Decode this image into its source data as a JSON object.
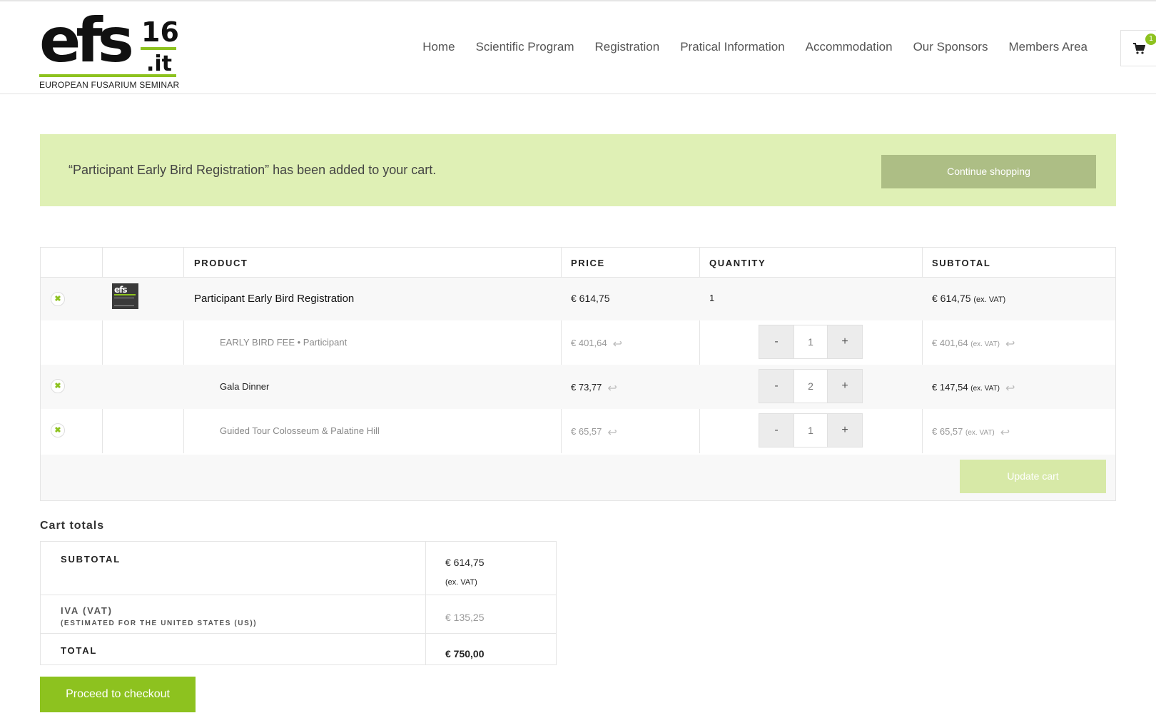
{
  "logo": {
    "mark": "efs",
    "number": "16",
    "domain": ".it",
    "tagline": "EUROPEAN FUSARIUM SEMINAR"
  },
  "nav": {
    "items": [
      "Home",
      "Scientific Program",
      "Registration",
      "Pratical Information",
      "Accommodation",
      "Our Sponsors",
      "Members Area"
    ]
  },
  "cart": {
    "icon": "cart-icon",
    "count": "1"
  },
  "notice": {
    "message": "“Participant Early Bird Registration” has been added to your cart.",
    "continue_label": "Continue shopping"
  },
  "table": {
    "headers": {
      "product": "PRODUCT",
      "price": "PRICE",
      "quantity": "QUANTITY",
      "subtotal": "SUBTOTAL"
    },
    "main_item": {
      "name": "Participant Early Bird Registration",
      "price": "€ 614,75",
      "quantity": "1",
      "subtotal": "€ 614,75",
      "subtotal_suffix": "(ex. VAT)"
    },
    "sub_items": [
      {
        "name": "EARLY BIRD FEE • Participant",
        "price": "€ 401,64",
        "qty": "1",
        "subtotal": "€ 401,64",
        "suffix": "(ex. VAT)",
        "minus": "-",
        "plus": "+"
      },
      {
        "name": "Gala Dinner",
        "price": "€ 73,77",
        "qty": "2",
        "subtotal": "€ 147,54",
        "suffix": "(ex. VAT)",
        "minus": "-",
        "plus": "+"
      },
      {
        "name": "Guided Tour Colosseum & Palatine Hill",
        "price": "€ 65,57",
        "qty": "1",
        "subtotal": "€ 65,57",
        "suffix": "(ex. VAT)",
        "minus": "-",
        "plus": "+"
      }
    ],
    "update_label": "Update cart"
  },
  "totals": {
    "title": "Cart totals",
    "subtotal_label": "SUBTOTAL",
    "subtotal_value": "€ 614,75",
    "subtotal_note": "(ex. VAT)",
    "vat_label": "IVA (VAT)",
    "vat_note": "(ESTIMATED FOR THE UNITED STATES (US))",
    "vat_value": "€ 135,25",
    "total_label": "TOTAL",
    "total_value": "€ 750,00"
  },
  "checkout_label": "Proceed to checkout",
  "colors": {
    "accent": "#8dc21f",
    "notice_bg": "#dff0b5",
    "continue_bg": "#adbe85",
    "update_bg": "#d7e9a7"
  }
}
